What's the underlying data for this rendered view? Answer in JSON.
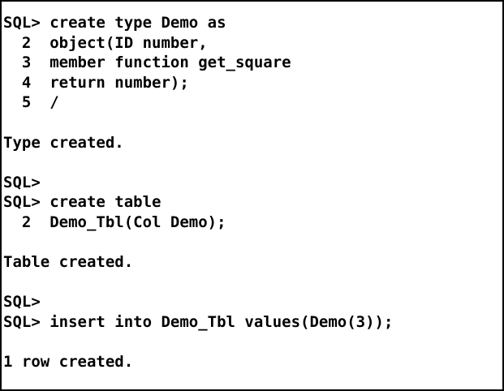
{
  "console": {
    "lines": [
      "SQL> create type Demo as",
      "  2  object(ID number,",
      "  3  member function get_square",
      "  4  return number);",
      "  5  /",
      "",
      "Type created.",
      "",
      "SQL>",
      "SQL> create table",
      "  2  Demo_Tbl(Col Demo);",
      "",
      "Table created.",
      "",
      "SQL>",
      "SQL> insert into Demo_Tbl values(Demo(3));",
      "",
      "1 row created."
    ]
  }
}
